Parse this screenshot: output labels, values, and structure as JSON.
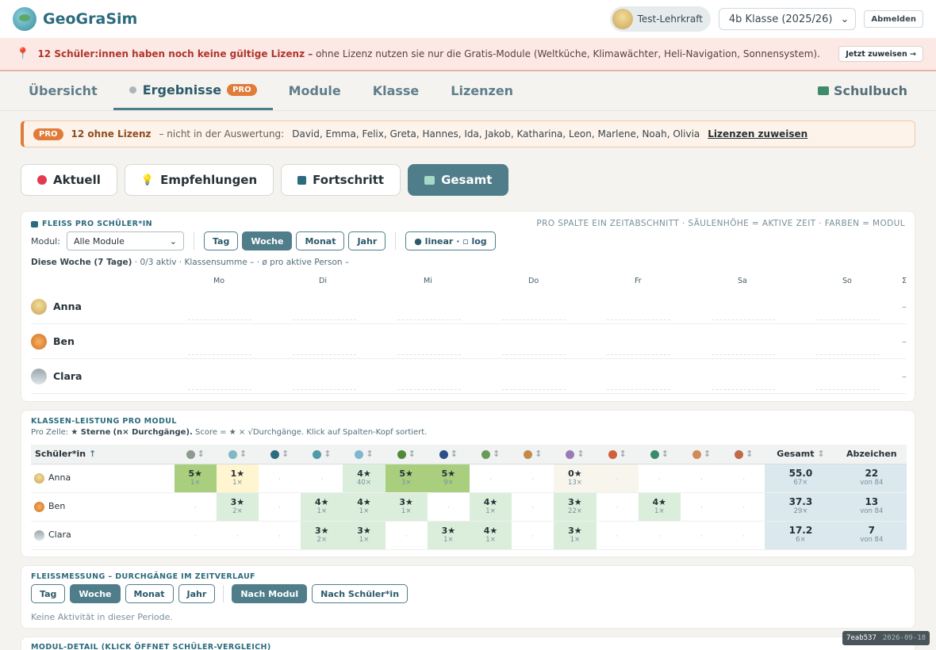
{
  "app": {
    "name": "GeoGraSim"
  },
  "header": {
    "teacher": "Test-Lehrkraft",
    "class_select": "4b Klasse (2025/26)",
    "logout": "Abmelden"
  },
  "banner": {
    "bold": "12 Schüler:innen haben noch keine gültige Lizenz –",
    "text": "ohne Lizenz nutzen sie nur die Gratis-Module (Weltküche, Klimawächter, Heli-Navigation, Sonnensystem).",
    "action": "Jetzt zuweisen →"
  },
  "tabs": [
    {
      "label": "Übersicht"
    },
    {
      "label": "Ergebnisse",
      "badge": "PRO"
    },
    {
      "label": "Module"
    },
    {
      "label": "Klasse"
    },
    {
      "label": "Lizenzen"
    }
  ],
  "tab_book": "Schulbuch",
  "license_bar": {
    "badge": "PRO",
    "count": "12 ohne Lizenz",
    "note": "– nicht in der Auswertung:",
    "names": "David, Emma, Felix, Greta, Hannes, Ida, Jakob, Katharina, Leon, Marlene, Noah, Olivia",
    "link": "Lizenzen zuweisen"
  },
  "views": [
    {
      "label": "Aktuell",
      "icon_color": "#e53950"
    },
    {
      "label": "Empfehlungen",
      "icon_color": "#2b7d6a"
    },
    {
      "label": "Fortschritt",
      "icon_color": "#2b6b7d"
    },
    {
      "label": "Gesamt",
      "icon_color": "#a7d9c6"
    }
  ],
  "fleiss": {
    "title": "FLEISS PRO SCHÜLER*IN",
    "hint": "PRO SPALTE EIN ZEITABSCHNITT · SÄULENHÖHE = AKTIVE ZEIT · FARBEN = MODUL",
    "module_label": "Modul:",
    "module_value": "Alle Module",
    "periods": [
      "Tag",
      "Woche",
      "Monat",
      "Jahr"
    ],
    "scale": "● linear · ▫ log",
    "summary_bold": "Diese Woche (7 Tage)",
    "summary": "· 0/3 aktiv · Klassensumme – · ø pro aktive Person –",
    "days": [
      "Mo",
      "Di",
      "Mi",
      "Do",
      "Fr",
      "Sa",
      "So"
    ],
    "sum_col": "Σ",
    "students": [
      {
        "name": "Anna",
        "avatar": "anna",
        "total": "–"
      },
      {
        "name": "Ben",
        "avatar": "ben",
        "total": "–"
      },
      {
        "name": "Clara",
        "avatar": "clara",
        "total": "–"
      }
    ]
  },
  "leistung": {
    "title": "KLASSEN-LEISTUNG PRO MODUL",
    "legend_prefix": "Pro Zelle:",
    "legend_stars": "★ Sterne",
    "legend_runs": "(n× Durchgänge).",
    "legend_rest": "Score = ★ × √Durchgänge. Klick auf Spalten-Kopf sortiert.",
    "col_student": "Schüler*in",
    "col_total": "Gesamt",
    "col_badge": "Abzeichen",
    "module_icons": [
      "#8d9a8f",
      "#7fb7c4",
      "#2b6b7d",
      "#4f9aa8",
      "#7fb7d0",
      "#4f8a3a",
      "#2a4f8a",
      "#6a9a5a",
      "#c58a4a",
      "#9a7ab4",
      "#d0603a",
      "#3a8a6a",
      "#d08a5a",
      "#c06a4a"
    ],
    "rows": [
      {
        "name": "Anna",
        "avatar": "anna",
        "cells": [
          [
            "5★",
            "1×",
            "hi"
          ],
          [
            "1★",
            "1×",
            "y"
          ],
          [
            "·",
            "",
            "n"
          ],
          [
            "·",
            "",
            "n"
          ],
          [
            "4★",
            "40×",
            "mid"
          ],
          [
            "5★",
            "3×",
            "hi"
          ],
          [
            "5★",
            "9×",
            "hi"
          ],
          [
            "·",
            "",
            "n"
          ],
          [
            "·",
            "",
            "n"
          ],
          [
            "0★",
            "13×",
            "g"
          ],
          [
            "·",
            "",
            "g"
          ],
          [
            "·",
            "",
            "n"
          ],
          [
            "·",
            "",
            "n"
          ],
          [
            "·",
            "",
            "n"
          ]
        ],
        "total": "55.0",
        "total_runs": "67×",
        "badges": "22",
        "badges_of": "von 84"
      },
      {
        "name": "Ben",
        "avatar": "ben",
        "cells": [
          [
            "·",
            "",
            "n"
          ],
          [
            "3★",
            "2×",
            "mid"
          ],
          [
            "·",
            "",
            "n"
          ],
          [
            "4★",
            "1×",
            "mid"
          ],
          [
            "4★",
            "1×",
            "mid"
          ],
          [
            "3★",
            "1×",
            "mid"
          ],
          [
            "·",
            "",
            "n"
          ],
          [
            "4★",
            "1×",
            "mid"
          ],
          [
            "·",
            "",
            "n"
          ],
          [
            "3★",
            "22×",
            "mid"
          ],
          [
            "·",
            "",
            "n"
          ],
          [
            "4★",
            "1×",
            "mid"
          ],
          [
            "·",
            "",
            "n"
          ],
          [
            "·",
            "",
            "n"
          ]
        ],
        "total": "37.3",
        "total_runs": "29×",
        "badges": "13",
        "badges_of": "von 84"
      },
      {
        "name": "Clara",
        "avatar": "clara",
        "cells": [
          [
            "·",
            "",
            "n"
          ],
          [
            "·",
            "",
            "n"
          ],
          [
            "·",
            "",
            "n"
          ],
          [
            "3★",
            "2×",
            "mid"
          ],
          [
            "3★",
            "1×",
            "mid"
          ],
          [
            "·",
            "",
            "n"
          ],
          [
            "3★",
            "1×",
            "mid"
          ],
          [
            "4★",
            "1×",
            "mid"
          ],
          [
            "·",
            "",
            "n"
          ],
          [
            "3★",
            "1×",
            "mid"
          ],
          [
            "·",
            "",
            "n"
          ],
          [
            "·",
            "",
            "n"
          ],
          [
            "·",
            "",
            "n"
          ],
          [
            "·",
            "",
            "n"
          ]
        ],
        "total": "17.2",
        "total_runs": "6×",
        "badges": "7",
        "badges_of": "von 84"
      }
    ]
  },
  "durchgaenge": {
    "title": "FLEISSMESSUNG – DURCHGÄNGE IM ZEITVERLAUF",
    "periods": [
      "Tag",
      "Woche",
      "Monat",
      "Jahr"
    ],
    "modes": [
      "Nach Modul",
      "Nach Schüler*in"
    ],
    "empty": "Keine Aktivität in dieser Periode."
  },
  "modul_detail": {
    "title": "MODUL-DETAIL (KLICK ÖFFNET SCHÜLER-VERGLEICH)"
  },
  "version": {
    "hash": "7eab537",
    "date": "2026-09-18"
  }
}
